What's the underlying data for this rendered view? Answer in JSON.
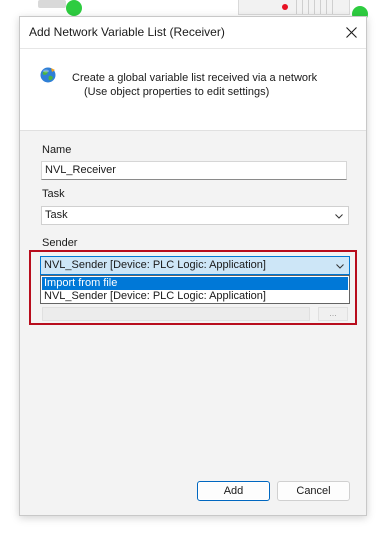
{
  "window": {
    "title": "Add Network Variable List (Receiver)"
  },
  "header": {
    "description_line1": "Create a global variable list received via a network",
    "description_line2": "(Use object properties to edit settings)",
    "icon": "globe-network-icon"
  },
  "form": {
    "name_label": "Name",
    "name_value": "NVL_Receiver",
    "task_label": "Task",
    "task_value": "Task",
    "sender_label": "Sender",
    "sender_value": "NVL_Sender [Device: PLC Logic: Application]",
    "sender_options": [
      "Import from file",
      "NVL_Sender [Device: PLC Logic: Application]"
    ],
    "browse_label": "..."
  },
  "buttons": {
    "add_label": "Add",
    "cancel_label": "Cancel"
  },
  "colors": {
    "accent": "#0078d7",
    "highlight_frame": "#b80d1d",
    "dialog_bg": "#f3f3f3"
  }
}
